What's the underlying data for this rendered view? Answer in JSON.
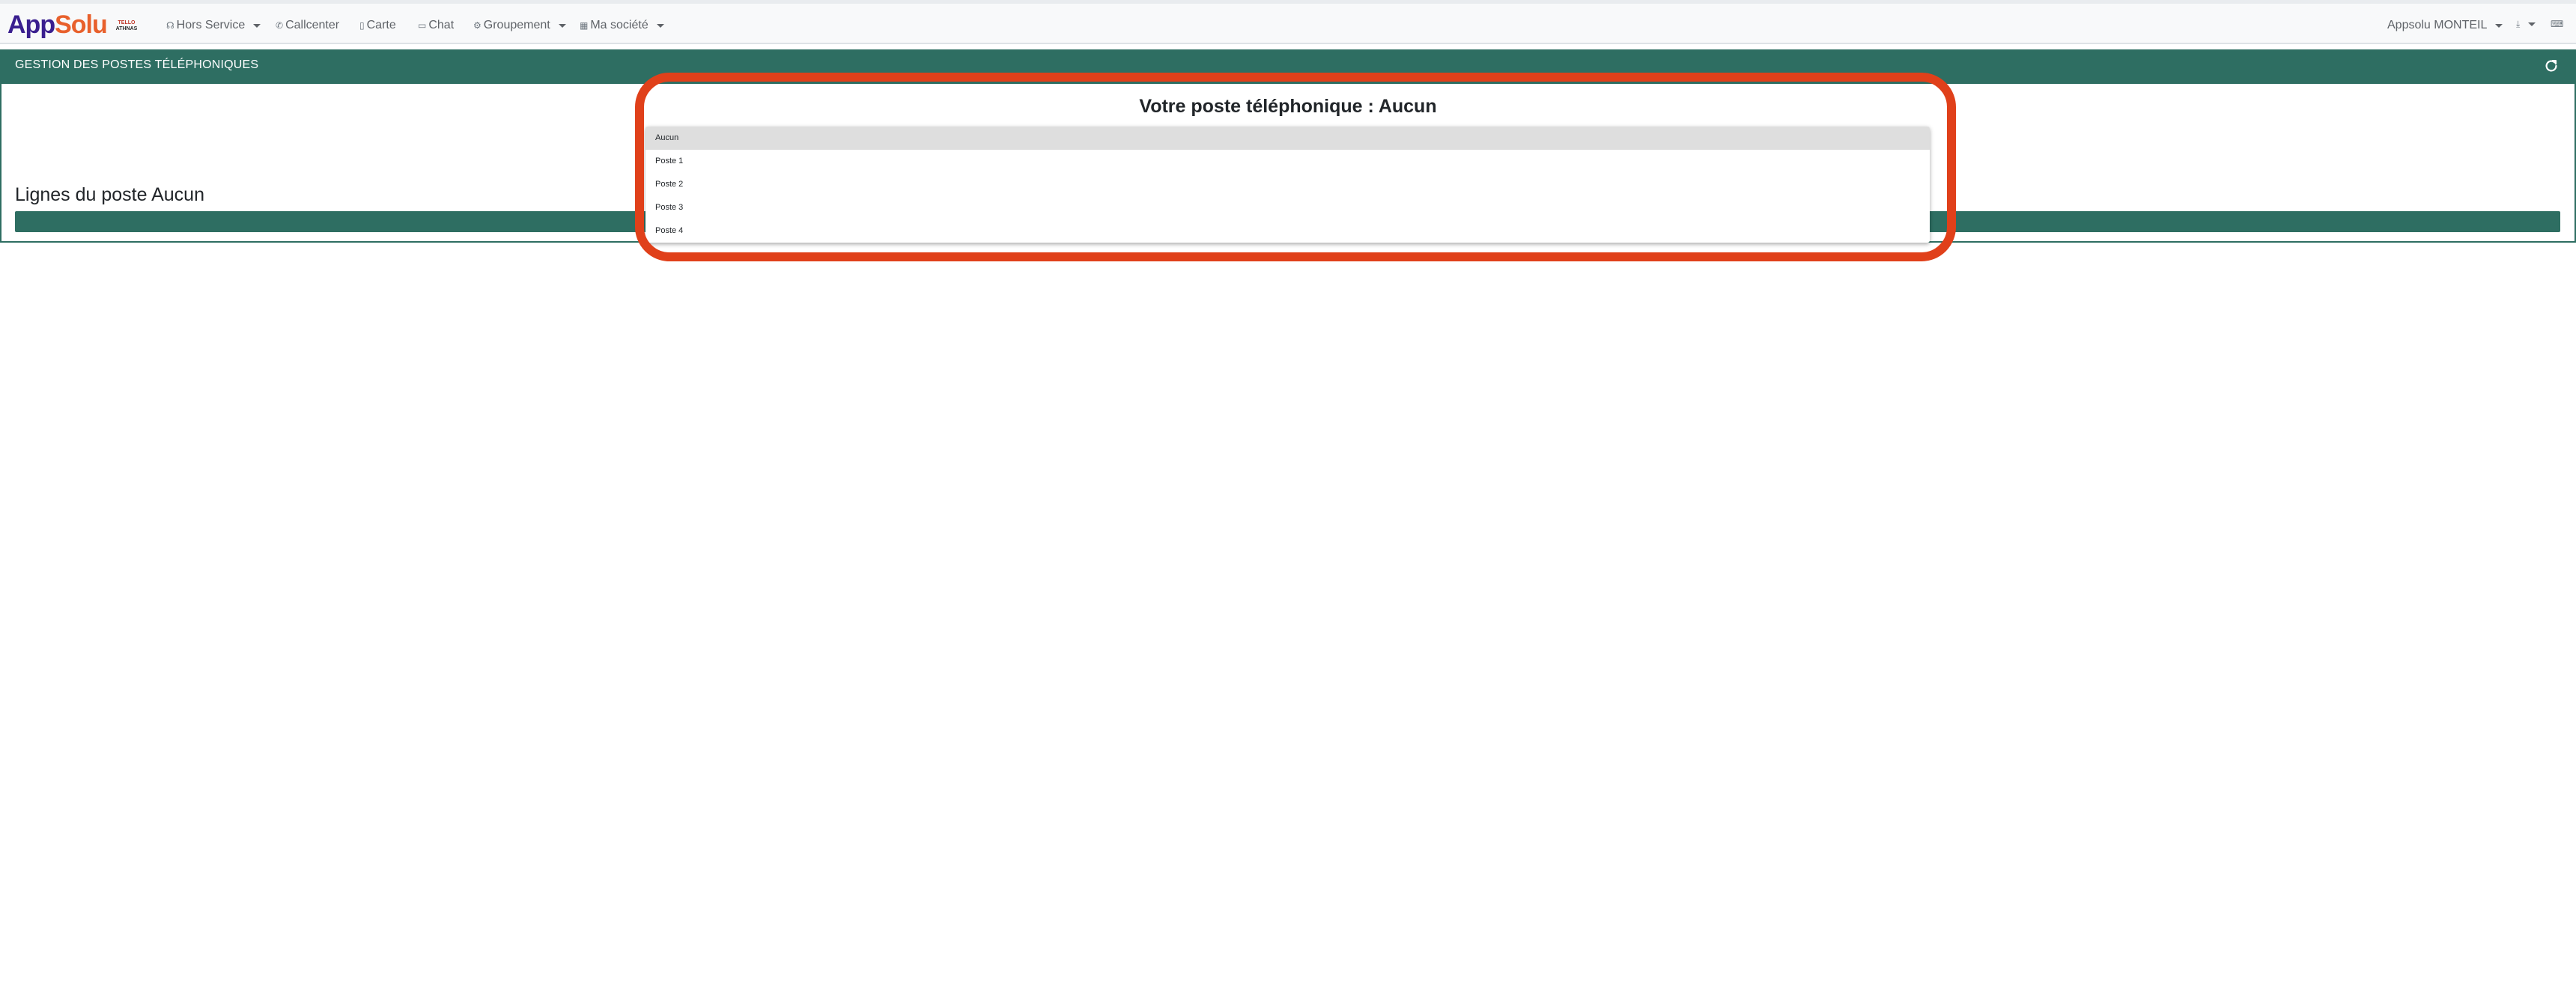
{
  "navbar": {
    "brand": {
      "part1": "App",
      "part2": "Solu"
    },
    "partner_logo": {
      "line1": "TELLO",
      "line2": "ATHNAS"
    },
    "items": [
      {
        "label": "Hors Service",
        "icon": "headset-icon",
        "has_caret": true
      },
      {
        "label": "Callcenter",
        "icon": "phone-icon",
        "has_caret": false
      },
      {
        "label": "Carte",
        "icon": "map-icon",
        "has_caret": false
      },
      {
        "label": "Chat",
        "icon": "chat-icon",
        "has_caret": false
      },
      {
        "label": "Groupement",
        "icon": "gear-icon",
        "has_caret": true
      },
      {
        "label": "Ma société",
        "icon": "building-icon",
        "has_caret": true
      }
    ],
    "user_menu": {
      "label": "Appsolu MONTEIL"
    }
  },
  "panel": {
    "title": "GESTION DES POSTES TÉLÉPHONIQUES",
    "heading": "Votre poste téléphonique : Aucun",
    "lines_title": "Lignes du poste Aucun"
  },
  "dropdown": {
    "selected": "Aucun",
    "options": [
      "Aucun",
      "Poste 1",
      "Poste 2",
      "Poste 3",
      "Poste 4"
    ]
  },
  "colors": {
    "panel_green": "#2e6e62",
    "highlight": "#e0401a",
    "brand_purple": "#3a1f8f",
    "brand_orange": "#e8602c"
  }
}
